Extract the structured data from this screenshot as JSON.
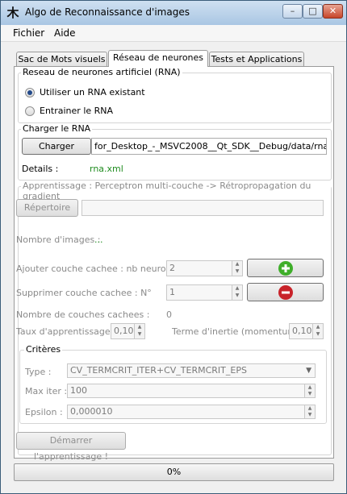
{
  "window": {
    "title": "Algo de Reconnaissance d'images",
    "app_icon": "app-logo-icon",
    "controls": {
      "minimize": "–",
      "maximize": "□",
      "close": "✕"
    }
  },
  "menubar": {
    "items": [
      "Fichier",
      "Aide"
    ]
  },
  "tabs": [
    {
      "label": "Sac de Mots visuels",
      "active": false
    },
    {
      "label": "Réseau de neurones",
      "active": true
    },
    {
      "label": "Tests et Applications",
      "active": false
    }
  ],
  "rna_group": {
    "title": "Reseau de neurones artificiel (RNA)",
    "options": [
      {
        "label": "Utiliser un RNA existant",
        "checked": true
      },
      {
        "label": "Entrainer le RNA",
        "checked": false
      }
    ]
  },
  "load_group": {
    "title": "Charger le RNA",
    "button": "Charger",
    "path": "for_Desktop_-_MSVC2008__Qt_SDK__Debug/data/rna.xml",
    "details_label": "Details :",
    "details_value": "rna.xml"
  },
  "learning_group": {
    "title": "Apprentissage : Perceptron multi-couche -> Rétropropagation du gradient",
    "dir_button": "Répertoire",
    "dir_value": "",
    "image_count_label": "Nombre d'images :",
    "image_count_value": "...",
    "add_layer_label": "Ajouter couche cachee : nb neurones",
    "add_layer_value": "2",
    "remove_layer_label": "Supprimer couche cachee :  N°",
    "remove_layer_value": "1",
    "layer_count_label": "Nombre de couches cachees :",
    "layer_count_value": "0",
    "rate_label": "Taux d'apprentissage :",
    "rate_value": "0,10",
    "momentum_label": "Terme d'inertie (momentum) :",
    "momentum_value": "0,10",
    "criteria": {
      "title": "Critères",
      "type_label": "Type :",
      "type_value": "CV_TERMCRIT_ITER+CV_TERMCRIT_EPS",
      "maxiter_label": "Max iter :",
      "maxiter_value": "100",
      "epsilon_label": "Epsilon :",
      "epsilon_value": "0,000010"
    },
    "start_button": "Démarrer l'apprentissage !"
  },
  "progress": {
    "value": 0,
    "text": "0%"
  },
  "colors": {
    "add": "#3fae2a",
    "remove": "#c8232a",
    "accent_green": "#1f8c1f"
  }
}
